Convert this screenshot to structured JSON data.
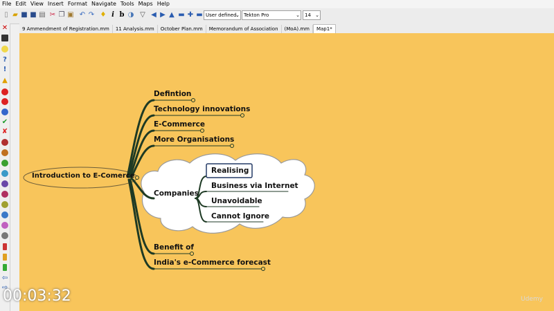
{
  "menu": [
    "File",
    "Edit",
    "View",
    "Insert",
    "Format",
    "Navigate",
    "Tools",
    "Maps",
    "Help"
  ],
  "toolbar": {
    "style_select": "User defined.",
    "font_select": "Tekton Pro",
    "size_select": "14"
  },
  "tabs": [
    "9 Ammendment of Registration.mm",
    "11 Analysis.mm",
    "October Plan.mm",
    "Memorandum of Association",
    "(MoA).mm",
    "Map1*"
  ],
  "mindmap": {
    "root": "Introduction to E-Comerce",
    "branches": [
      "Defintion",
      "Technology innovations",
      "E-Commerce",
      "More Organisations",
      "Companies",
      "Benefit of",
      "India's e-Commerce forecast"
    ],
    "companies_children": [
      "Realising",
      "Business via Internet",
      "Unavoidable",
      "Cannot Ignore"
    ]
  },
  "timer": "00:03:32",
  "watermark": "Udemy",
  "colors": {
    "canvas": "#f8c55b",
    "branch_line": "#1e3a24",
    "cloud": "#ffffff",
    "selected_border": "#243a66"
  }
}
